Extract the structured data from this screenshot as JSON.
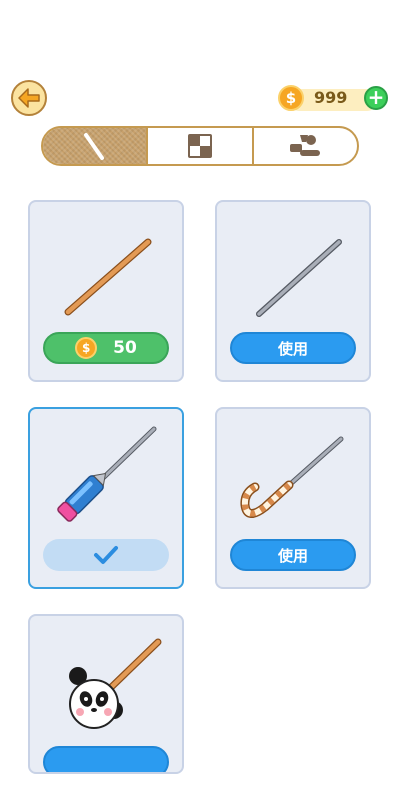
{
  "header": {
    "back_icon": "arrow-left-icon",
    "coin_symbol": "$",
    "coin_amount": "999",
    "add_icon": "plus-icon"
  },
  "tabs": [
    {
      "icon": "stick-icon",
      "active": true
    },
    {
      "icon": "checker-icon",
      "active": false
    },
    {
      "icon": "tools-icon",
      "active": false
    }
  ],
  "items": [
    {
      "icon": "wooden-stick-icon",
      "action": "price",
      "price_symbol": "$",
      "price": "50"
    },
    {
      "icon": "metal-needle-icon",
      "action": "use",
      "label": "使用"
    },
    {
      "icon": "pencil-needle-icon",
      "action": "selected",
      "check_icon": "checkmark-icon"
    },
    {
      "icon": "candy-cane-needle-icon",
      "action": "use",
      "label": "使用"
    },
    {
      "icon": "panda-stick-icon",
      "action": "use"
    }
  ],
  "colors": {
    "accent_gold": "#c59a50",
    "buy_green": "#4ec16a",
    "use_blue": "#2b9bf0",
    "selected_light_blue": "#c2dcf4",
    "card_bg": "#e9edf5"
  }
}
